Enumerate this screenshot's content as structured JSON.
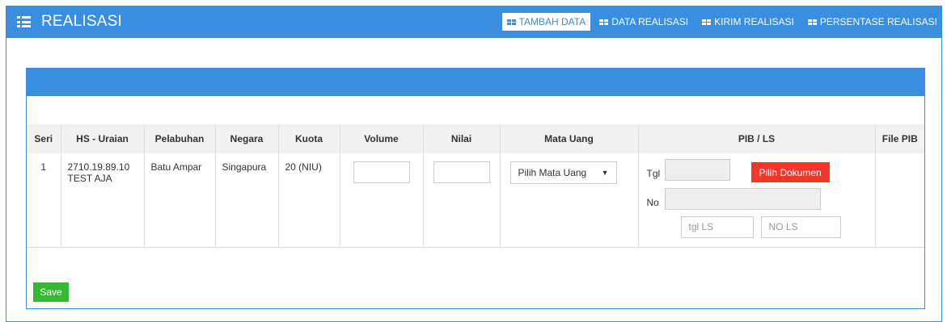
{
  "header": {
    "title": "REALISASI",
    "nav": [
      {
        "label": "TAMBAH DATA",
        "active": true
      },
      {
        "label": "DATA REALISASI",
        "active": false
      },
      {
        "label": "KIRIM REALISASI",
        "active": false
      },
      {
        "label": "PERSENTASE REALISASI",
        "active": false
      }
    ]
  },
  "table": {
    "columns": [
      "Seri",
      "HS - Uraian",
      "Pelabuhan",
      "Negara",
      "Kuota",
      "Volume",
      "Nilai",
      "Mata Uang",
      "PIB / LS",
      "File PIB"
    ],
    "row": {
      "seri": "1",
      "hs_code": "2710.19.89.10",
      "uraian": "TEST AJA",
      "pelabuhan": "Batu Ampar",
      "negara": "Singapura",
      "kuota": "20 (NIU)",
      "volume": "",
      "nilai": "",
      "mata_uang": "Pilih Mata Uang",
      "pib": {
        "tgl_label": "Tgl",
        "no_label": "No",
        "pilih_dokumen": "Pilih Dokumen",
        "tgl_ls_placeholder": "tgl LS",
        "no_ls_placeholder": "NO LS"
      }
    }
  },
  "save_label": "Save",
  "colors": {
    "primary": "#3a8ee0",
    "danger": "#f4352a",
    "success": "#35b935"
  }
}
